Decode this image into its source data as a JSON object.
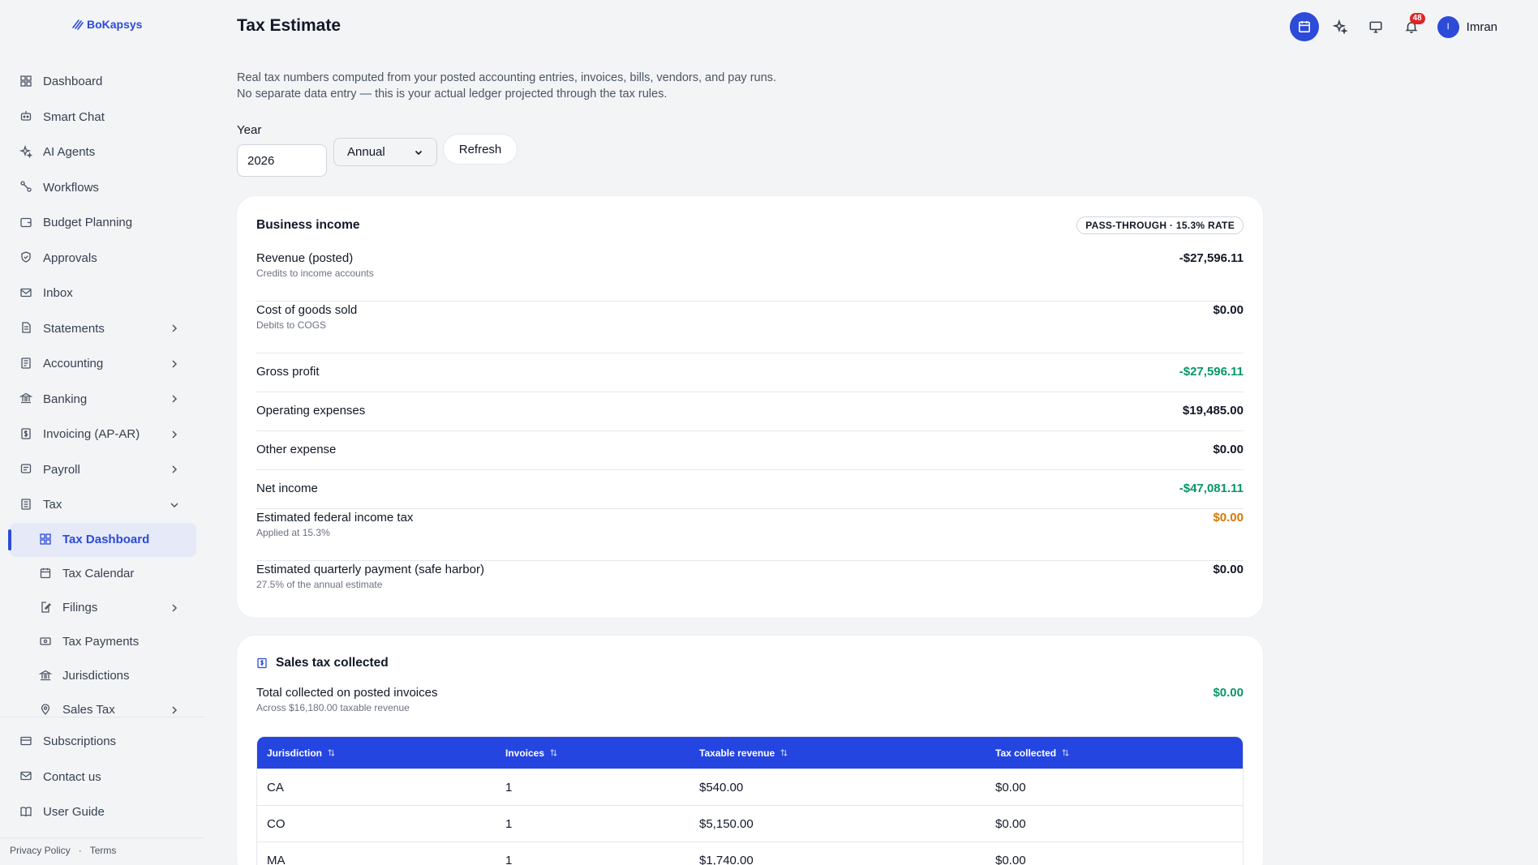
{
  "app": {
    "logo_text": "BoKapsys"
  },
  "sidebar": {
    "items": [
      {
        "label": "Dashboard",
        "icon": "grid-icon"
      },
      {
        "label": "Smart Chat",
        "icon": "robot-icon"
      },
      {
        "label": "AI Agents",
        "icon": "sparkles-icon"
      },
      {
        "label": "Workflows",
        "icon": "workflow-icon"
      },
      {
        "label": "Budget Planning",
        "icon": "wallet-icon"
      },
      {
        "label": "Approvals",
        "icon": "shield-check-icon"
      },
      {
        "label": "Inbox",
        "icon": "mail-icon"
      },
      {
        "label": "Statements",
        "icon": "document-icon"
      },
      {
        "label": "Accounting",
        "icon": "ledger-icon"
      },
      {
        "label": "Banking",
        "icon": "bank-icon"
      },
      {
        "label": "Invoicing (AP-AR)",
        "icon": "invoice-icon"
      },
      {
        "label": "Payroll",
        "icon": "payroll-icon"
      },
      {
        "label": "Tax",
        "icon": "tax-icon"
      }
    ],
    "tax_subitems": [
      {
        "label": "Tax Dashboard",
        "icon": "grid-icon"
      },
      {
        "label": "Tax Calendar",
        "icon": "calendar-icon"
      },
      {
        "label": "Filings",
        "icon": "edit-document-icon"
      },
      {
        "label": "Tax Payments",
        "icon": "payment-icon"
      },
      {
        "label": "Jurisdictions",
        "icon": "bank-icon"
      },
      {
        "label": "Sales Tax",
        "icon": "location-pin-icon"
      }
    ],
    "bottom_items": [
      {
        "label": "Subscriptions",
        "icon": "card-icon"
      },
      {
        "label": "Contact us",
        "icon": "mail-icon"
      },
      {
        "label": "User Guide",
        "icon": "book-icon"
      }
    ],
    "footer": {
      "privacy": "Privacy Policy",
      "separator": "·",
      "terms": "Terms"
    }
  },
  "header": {
    "title": "Tax Estimate",
    "notification_count": "48",
    "user_initial": "I",
    "user_name": "Imran"
  },
  "intro": "Real tax numbers computed from your posted accounting entries, invoices, bills, vendors, and pay runs. No separate data entry — this is your actual ledger projected through the tax rules.",
  "controls": {
    "year_label": "Year",
    "year_value": "2026",
    "period_value": "Annual",
    "refresh_label": "Refresh"
  },
  "business_income": {
    "title": "Business income",
    "badge": "PASS-THROUGH · 15.3% RATE",
    "rows": [
      {
        "label": "Revenue (posted)",
        "sub": "Credits to income accounts",
        "value": "-$27,596.11",
        "tone": "default"
      },
      {
        "label": "Cost of goods sold",
        "sub": "Debits to COGS",
        "value": "$0.00",
        "tone": "default"
      },
      {
        "label": "Gross profit",
        "sub": "",
        "value": "-$27,596.11",
        "tone": "green"
      },
      {
        "label": "Operating expenses",
        "sub": "",
        "value": "$19,485.00",
        "tone": "default"
      },
      {
        "label": "Other expense",
        "sub": "",
        "value": "$0.00",
        "tone": "default"
      },
      {
        "label": "Net income",
        "sub": "",
        "value": "-$47,081.11",
        "tone": "green"
      },
      {
        "label": "Estimated federal income tax",
        "sub": "Applied at 15.3%",
        "value": "$0.00",
        "tone": "orange"
      },
      {
        "label": "Estimated quarterly payment (safe harbor)",
        "sub": "27.5% of the annual estimate",
        "value": "$0.00",
        "tone": "default"
      }
    ]
  },
  "sales_tax": {
    "title": "Sales tax collected",
    "total_label": "Total collected on posted invoices",
    "total_sub": "Across $16,180.00 taxable revenue",
    "total_value": "$0.00",
    "columns": [
      "Jurisdiction",
      "Invoices",
      "Taxable revenue",
      "Tax collected"
    ],
    "rows": [
      [
        "CA",
        "1",
        "$540.00",
        "$0.00"
      ],
      [
        "CO",
        "1",
        "$5,150.00",
        "$0.00"
      ],
      [
        "MA",
        "1",
        "$1,740.00",
        "$0.00"
      ]
    ]
  },
  "colors": {
    "accent": "#2b4bd8",
    "table_header": "#2445e0",
    "positive": "#059669",
    "warning": "#d97706",
    "badge": "#dc2626"
  }
}
